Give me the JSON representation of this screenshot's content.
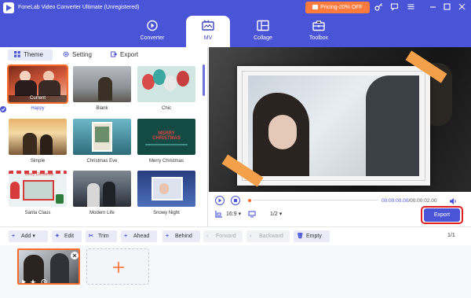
{
  "app": {
    "title": "FoneLab Video Converter Ultimate (Unregistered)"
  },
  "promo": {
    "label": "Pricing-20% OFF"
  },
  "nav": {
    "tabs": [
      {
        "label": "Converter"
      },
      {
        "label": "MV"
      },
      {
        "label": "Collage"
      },
      {
        "label": "Toolbox"
      }
    ]
  },
  "subtabs": [
    {
      "label": "Theme"
    },
    {
      "label": "Setting"
    },
    {
      "label": "Export"
    }
  ],
  "themes": [
    {
      "name": "Happy"
    },
    {
      "name": "Blank"
    },
    {
      "name": "Chic"
    },
    {
      "name": "Simple"
    },
    {
      "name": "Christmas Eve"
    },
    {
      "name": "Merry Christmas"
    },
    {
      "name": "Santa Claus"
    },
    {
      "name": "Modern Life"
    },
    {
      "name": "Snowy Night"
    }
  ],
  "current_badge": "Current",
  "thumb_text": {
    "merry": "MERRY CHRISTMAS",
    "santa": "Merry Christmas"
  },
  "player": {
    "time_current": "00:00:00.00",
    "time_total": "/00:00:02.00",
    "ratio": "16:9",
    "page": "1/2",
    "export_label": "Export"
  },
  "toolbar": {
    "add": "Add",
    "edit": "Edit",
    "trim": "Trim",
    "ahead": "Ahead",
    "behind": "Behind",
    "forward": "Forward",
    "backward": "Backward",
    "empty": "Empty",
    "page_current": "1",
    "page_total": "/1"
  },
  "colors": {
    "brand": "#4a54d6",
    "accent": "#ff6b2a",
    "highlight": "#e02020"
  }
}
